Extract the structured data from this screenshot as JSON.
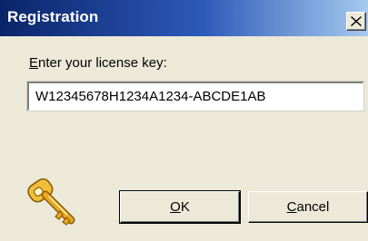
{
  "window": {
    "title": "Registration"
  },
  "titlebar": {
    "close_icon": "close-icon"
  },
  "form": {
    "prompt_access_key": "E",
    "prompt_rest": "nter your license key:",
    "license_value": "W12345678H1234A1234-ABCDE1AB"
  },
  "buttons": {
    "ok_access_key": "O",
    "ok_rest": "K",
    "cancel_access_key": "C",
    "cancel_rest": "ancel"
  },
  "icons": {
    "key": "key-icon"
  },
  "colors": {
    "titlebar_start": "#0a246a",
    "titlebar_end": "#a6caf0",
    "dialog_face": "#ece9d8",
    "key_gold": "#e8a820"
  }
}
